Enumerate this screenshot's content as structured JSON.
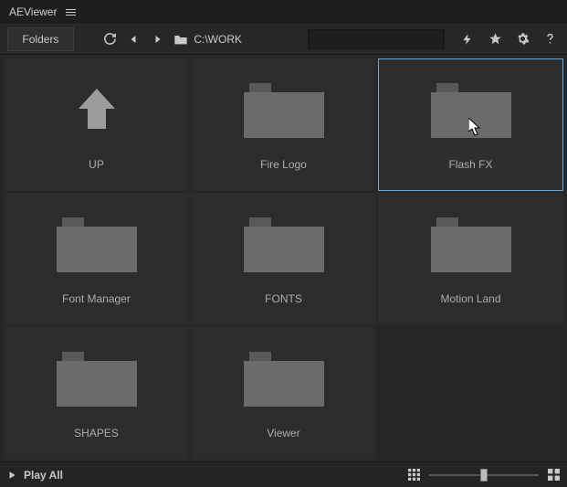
{
  "app": {
    "title": "AEViewer"
  },
  "toolbar": {
    "folders_label": "Folders",
    "path_text": "C:\\WORK",
    "search_placeholder": ""
  },
  "icons": {
    "menu": "menu-icon",
    "refresh": "refresh-icon",
    "back": "arrow-left-icon",
    "forward": "arrow-right-icon",
    "folder": "folder-icon",
    "search": "search-icon",
    "bolt": "bolt-icon",
    "star": "star-icon",
    "gear": "gear-icon",
    "help": "help-icon",
    "play": "play-icon",
    "grid_small": "grid-small-icon",
    "grid_large": "grid-large-icon"
  },
  "grid": {
    "selected_index": 2,
    "items": [
      {
        "label": "UP",
        "icon": "up"
      },
      {
        "label": "Fire Logo",
        "icon": "folder"
      },
      {
        "label": "Flash FX",
        "icon": "folder"
      },
      {
        "label": "Font Manager",
        "icon": "folder"
      },
      {
        "label": "FONTS",
        "icon": "folder"
      },
      {
        "label": "Motion Land",
        "icon": "folder"
      },
      {
        "label": "SHAPES",
        "icon": "folder"
      },
      {
        "label": "Viewer",
        "icon": "folder"
      }
    ]
  },
  "footer": {
    "play_all_label": "Play All",
    "thumb_size": 50
  },
  "colors": {
    "bg": "#272727",
    "cell_bg": "#2c2c2c",
    "accent": "#6aa7d6",
    "text": "#c8c8c8"
  }
}
